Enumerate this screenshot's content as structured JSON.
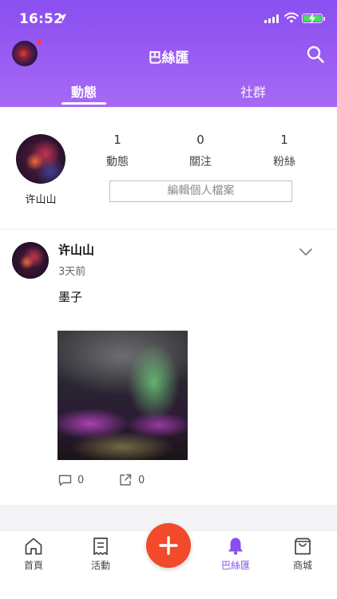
{
  "status_bar": {
    "time": "16:52"
  },
  "header": {
    "title": "巴絲匯",
    "tabs": [
      {
        "label": "動態",
        "active": true
      },
      {
        "label": "社群",
        "active": false
      }
    ]
  },
  "profile": {
    "name": "许山山",
    "stats": [
      {
        "value": "1",
        "label": "動態"
      },
      {
        "value": "0",
        "label": "關注"
      },
      {
        "value": "1",
        "label": "粉絲"
      }
    ],
    "edit_button": "編輯個人檔案"
  },
  "post": {
    "author": "许山山",
    "time": "3天前",
    "text": "墨子",
    "comment_count": "0",
    "share_count": "0"
  },
  "bottom_nav": {
    "items": [
      {
        "label": "首頁",
        "icon": "home-icon"
      },
      {
        "label": "活動",
        "icon": "receipt-icon"
      },
      {
        "label": "巴絲匯",
        "icon": "bell-icon",
        "active": true
      },
      {
        "label": "商城",
        "icon": "shopping-bag-icon"
      }
    ],
    "add_icon": "plus-icon"
  },
  "colors": {
    "accent": "#8a4ff0",
    "fab": "#f24a2a",
    "notification": "#ff3b30"
  }
}
